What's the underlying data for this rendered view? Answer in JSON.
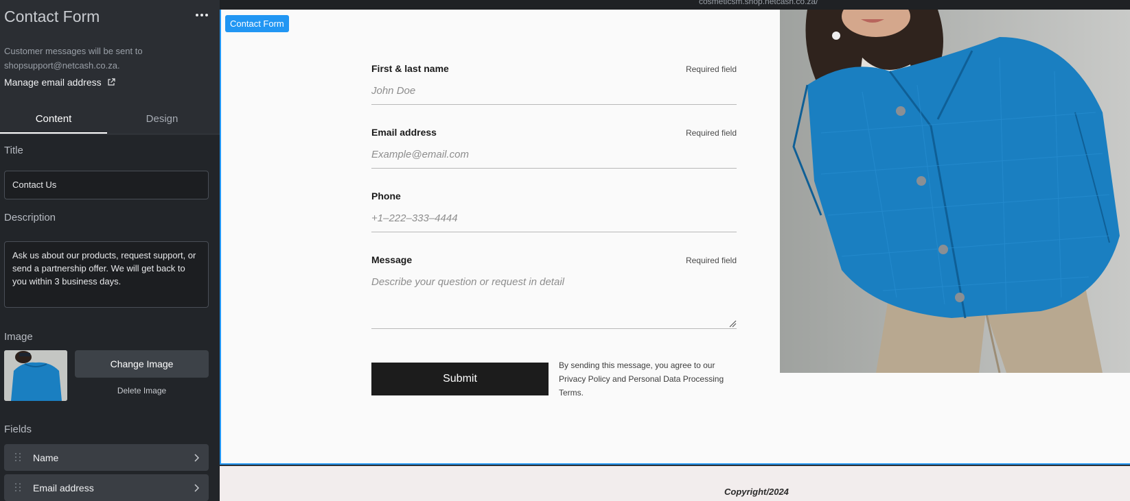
{
  "sidebar": {
    "title": "Contact Form",
    "note": "Customer messages will be sent to shopsupport@netcash.co.za.",
    "manage_link": "Manage email address",
    "tabs": [
      {
        "label": "Content"
      },
      {
        "label": "Design"
      }
    ],
    "title_section": {
      "label": "Title",
      "value": "Contact Us"
    },
    "description_section": {
      "label": "Description",
      "value": "Ask us about our products, request support, or send a partnership offer. We will get back to you within 3 business days."
    },
    "image_section": {
      "label": "Image",
      "change_label": "Change Image",
      "delete_label": "Delete Image"
    },
    "fields_section": {
      "label": "Fields",
      "items": [
        {
          "label": "Name"
        },
        {
          "label": "Email address"
        }
      ]
    }
  },
  "canvas": {
    "url": "cosmeticsm.shop.netcash.co.za/",
    "badge": "Contact Form",
    "form": {
      "fields": [
        {
          "label": "First & last name",
          "required": "Required field",
          "placeholder": "John Doe"
        },
        {
          "label": "Email address",
          "required": "Required field",
          "placeholder": "Example@email.com"
        },
        {
          "label": "Phone",
          "required": "",
          "placeholder": "+1–222–333–4444"
        },
        {
          "label": "Message",
          "required": "Required field",
          "placeholder": "Describe your question or request in detail"
        }
      ],
      "submit_label": "Submit",
      "terms": "By sending this message, you agree to our Privacy Policy and Personal Data Processing Terms."
    },
    "footer": "Copyright/2024"
  },
  "colors": {
    "accent": "#2196f3",
    "sidebar_bg": "#2b2e33",
    "jacket": "#1a7fc1",
    "submit_bg": "#1c1c1c"
  },
  "icons": [
    "more-icon",
    "external-link-icon",
    "drag-handle-icon",
    "chevron-right-icon",
    "resize-handle-icon"
  ]
}
